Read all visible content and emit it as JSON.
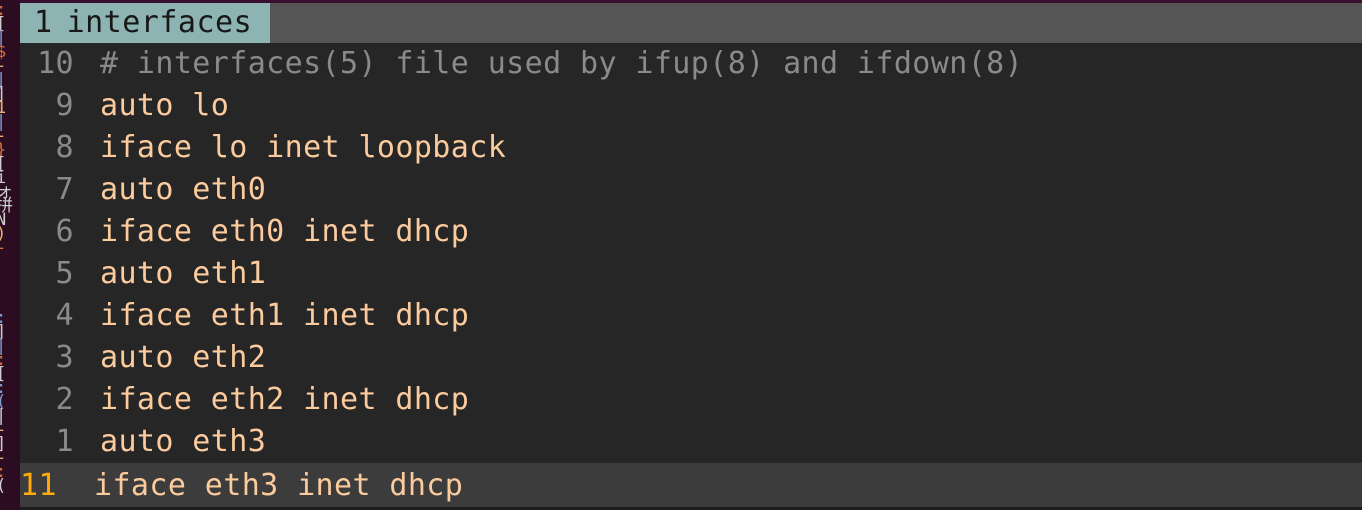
{
  "window": {
    "kind": "terminal-text-editor",
    "colors": {
      "background": "#262626",
      "header_bar": "#555555",
      "active_tab": "#8db3b3",
      "active_tab_text": "#181818",
      "line_number": "#8a8a8a",
      "code_text": "#fbcb9e",
      "comment_text": "#8a8a8a",
      "current_line_bg": "#3c3c3c",
      "current_line_number": "#ffab08",
      "background_terminal": "#2b0c21",
      "top_rule": "#3a1030"
    }
  },
  "tabbar": {
    "active_tab": {
      "index": "1",
      "title": "interfaces"
    }
  },
  "buffer": {
    "lines": [
      {
        "number": "10",
        "text": "# interfaces(5) file used by ifup(8) and ifdown(8)",
        "kind": "comment",
        "current": false
      },
      {
        "number": "9",
        "text": "auto lo",
        "kind": "code",
        "current": false
      },
      {
        "number": "8",
        "text": "iface lo inet loopback",
        "kind": "code",
        "current": false
      },
      {
        "number": "7",
        "text": "auto eth0",
        "kind": "code",
        "current": false
      },
      {
        "number": "6",
        "text": "iface eth0 inet dhcp",
        "kind": "code",
        "current": false
      },
      {
        "number": "5",
        "text": "auto eth1",
        "kind": "code",
        "current": false
      },
      {
        "number": "4",
        "text": "iface eth1 inet dhcp",
        "kind": "code",
        "current": false
      },
      {
        "number": "3",
        "text": "auto eth2",
        "kind": "code",
        "current": false
      },
      {
        "number": "2",
        "text": "iface eth2 inet dhcp",
        "kind": "code",
        "current": false
      },
      {
        "number": "1",
        "text": "auto eth3",
        "kind": "code",
        "current": false
      },
      {
        "number": "11",
        "text": "iface eth3 inet dhcp",
        "kind": "code",
        "current": true
      }
    ]
  },
  "background_terminal": {
    "fragments": [
      ":",
      "[",
      "|",
      "$",
      "-",
      "|",
      "]",
      "1",
      "|",
      "-",
      "}",
      "[",
      "i",
      "ォ",
      "拼",
      "N",
      ")",
      "-",
      " ",
      " ",
      " ",
      " ",
      ":",
      "]",
      "|",
      ":",
      "[",
      ":",
      "(",
      "|",
      "-",
      "]",
      "-",
      ":",
      "("
    ],
    "fragment_colors": [
      "#d4703a",
      "#cfcfcf",
      "#7b9fd4",
      "#d4703a",
      "#e8b070",
      "#7b9fd4",
      "#cfcfcf",
      "#e8b070",
      "#7b9fd4",
      "#e8b070",
      "#d4703a",
      "#cfcfcf",
      "#cfcfcf",
      "#cfcfcf",
      "#cfcfcf",
      "#cfcfcf",
      "#e8b070",
      "#d4703a",
      "#cfcfcf",
      "#cfcfcf",
      "#cfcfcf",
      "#cfcfcf",
      "#7b9fd4",
      "#cfcfcf",
      "#7b9fd4",
      "#d4703a",
      "#cfcfcf",
      "#7b9fd4",
      "#7b9fd4",
      "#cfcfcf",
      "#e8b070",
      "#cfcfcf",
      "#e8b070",
      "#d4703a",
      "#cfcfcf"
    ]
  }
}
